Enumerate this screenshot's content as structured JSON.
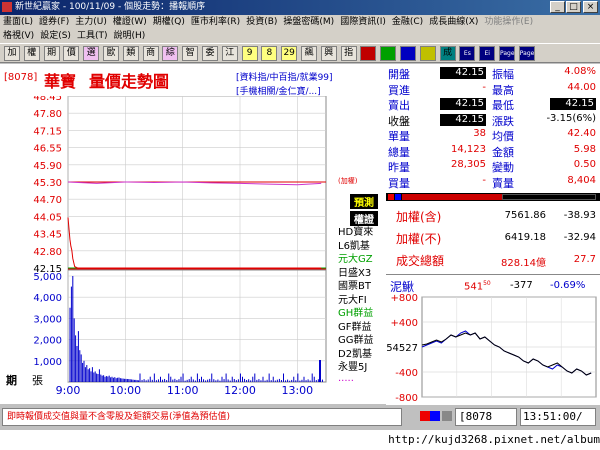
{
  "window": {
    "title": "新世紀贏家 - 100/11/09 - 個股走勢：播報順序"
  },
  "menu_row1": [
    "畫面(L)",
    "證券(F)",
    "主力(U)",
    "權證(W)",
    "期權(Q)",
    "匯市利率(R)",
    "投資(B)",
    "操盤密碼(M)",
    "國際資訊(I)",
    "金融(C)",
    "成長曲線(X)",
    "功能操作(E)"
  ],
  "menu_row2": [
    "格視(V)",
    "設定(S)",
    "工具(T)",
    "說明(H)"
  ],
  "toolbar": [
    "加",
    "權",
    "期",
    "價",
    "選",
    "歐",
    "類",
    "商",
    "綜",
    "智",
    "委",
    "江",
    "9",
    "8",
    "29",
    "飆",
    "興",
    "指",
    "",
    "",
    "",
    "",
    "成",
    "Es",
    "Ei",
    "Page",
    "Page"
  ],
  "stock": {
    "code": "[8078]",
    "name": "華寶",
    "chart_title": "量價走勢圖"
  },
  "links": {
    "line1": "[資料指/中百指/就業99]",
    "line2": "[手機相關/金仁寶/...]"
  },
  "price_axis": [
    "48.45",
    "47.80",
    "47.15",
    "46.55",
    "45.90",
    "45.30",
    "44.70",
    "44.05",
    "43.45",
    "42.80",
    "42.15"
  ],
  "volume_axis": [
    "5,000",
    "4,000",
    "3,000",
    "2,000",
    "1,000"
  ],
  "time_axis": [
    "9:00",
    "10:00",
    "11:00",
    "12:00",
    "13:00"
  ],
  "vol_label_1": "期",
  "vol_label_2": "張",
  "mid_note": "(加權)",
  "side_list": {
    "header1": "預測",
    "header2": "權證",
    "items": [
      "HD寶來",
      "L6凱基",
      "元大GZ",
      "日盛X3",
      "國票BT",
      "元大FI",
      "GH群益",
      "GF群益",
      "GG群益",
      "D2凱基",
      "永豐5J",
      "·····"
    ]
  },
  "quote": {
    "open_label": "開盤",
    "open": "42.15",
    "amp_label": "振幅",
    "amp": "4.08%",
    "buy_label": "買進",
    "buy": "-",
    "high_label": "最高",
    "high": "44.00",
    "sell_label": "賣出",
    "sell": "42.15",
    "low_label": "最低",
    "low": "42.15",
    "close_label": "收盤",
    "close": "42.15",
    "change_label": "漲跌",
    "change": "-3.15(6%)",
    "vol_label": "單量",
    "vol": "38",
    "avg_label": "均價",
    "avg": "42.40",
    "total_label": "總量",
    "total": "14,123",
    "amount_label": "金額",
    "amount": "5.98",
    "yest_label": "昨量",
    "yest": "28,305",
    "varia_label": "變動",
    "varia": "0.50",
    "bv_label": "買量",
    "bv": "-",
    "sv_label": "賣量",
    "sv": "8,404"
  },
  "index": {
    "w_in_label": "加權(含)",
    "w_in": "7561.86",
    "w_in_chg": "-38.93",
    "w_ex_label": "加權(不)",
    "w_ex": "6419.18",
    "w_ex_chg": "-32.94",
    "amount_label": "成交總額",
    "amount": "828.14億",
    "amount_chg": "27.7"
  },
  "mini": {
    "name": "泥鰍",
    "price": "541",
    "price_sup": "50",
    "chg": "-377",
    "pct": "-0.69%",
    "axis": [
      "+800",
      "+400",
      "54527",
      "-400",
      "-800"
    ]
  },
  "status": {
    "left": "即時報價成交值與量不含零股及鉅額交易(淨值為預估值)",
    "code": "[8078",
    "time": "13:51:00/"
  },
  "url": "http://kujd3268.pixnet.net/album",
  "chart_data": {
    "type": "line",
    "price_ylim": [
      42.15,
      48.45
    ],
    "volume_ylim": [
      0,
      5000
    ],
    "x_ticks": [
      "9:00",
      "10:00",
      "11:00",
      "12:00",
      "13:00"
    ],
    "series": [
      {
        "name": "price",
        "x_minutes": [
          0,
          2,
          3,
          4,
          5,
          7,
          10,
          30,
          60,
          120,
          180,
          230,
          265
        ],
        "values": [
          44.0,
          43.2,
          42.95,
          42.8,
          42.5,
          42.2,
          42.15,
          42.15,
          42.15,
          42.15,
          42.15,
          42.15,
          42.15
        ]
      },
      {
        "name": "加權",
        "x_minutes": [
          0,
          30,
          60,
          90,
          120,
          150,
          180,
          210,
          240,
          265
        ],
        "values": [
          45.3,
          45.25,
          45.3,
          45.28,
          45.3,
          45.27,
          45.25,
          45.22,
          45.2,
          45.25
        ]
      }
    ],
    "reference_price": 45.3
  }
}
